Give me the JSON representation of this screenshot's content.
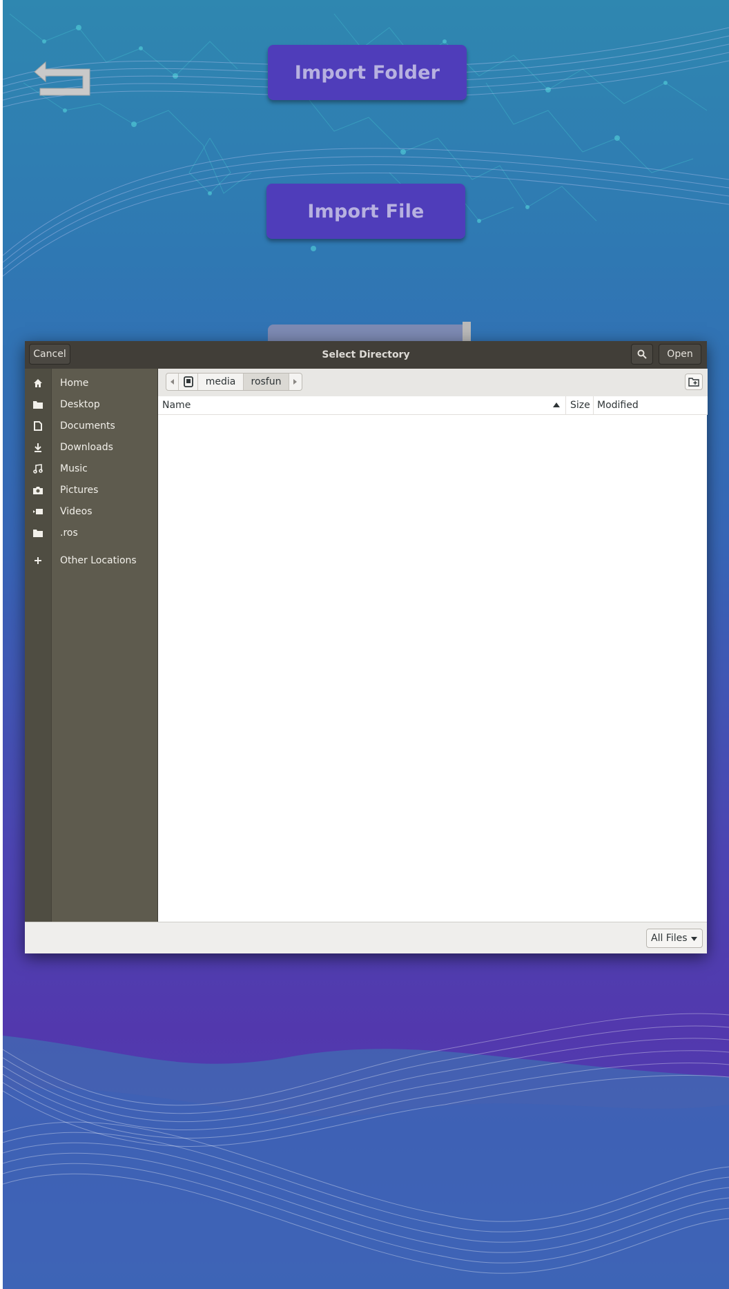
{
  "app": {
    "buttons": {
      "import_folder": "Import Folder",
      "import_file": "Import File"
    },
    "colors": {
      "background_top": "#2f87b0",
      "background_bottom": "#5238ad",
      "button": "#4f3dba",
      "button_text": "#b7b1e0"
    },
    "icons": {
      "back": "back-arrow-icon"
    }
  },
  "dialog": {
    "title": "Select Directory",
    "cancel_label": "Cancel",
    "open_label": "Open",
    "search_icon": "search-icon",
    "places": [
      {
        "label": "Home",
        "icon": "home-icon"
      },
      {
        "label": "Desktop",
        "icon": "folder-icon"
      },
      {
        "label": "Documents",
        "icon": "document-icon"
      },
      {
        "label": "Downloads",
        "icon": "download-icon"
      },
      {
        "label": "Music",
        "icon": "music-icon"
      },
      {
        "label": "Pictures",
        "icon": "camera-icon"
      },
      {
        "label": "Videos",
        "icon": "video-icon"
      },
      {
        "label": ".ros",
        "icon": "folder-icon"
      },
      {
        "label": "Other Locations",
        "icon": "plus-icon"
      }
    ],
    "path": {
      "segments": [
        "media",
        "rosfun"
      ],
      "active": "rosfun",
      "drive_icon": "drive-icon"
    },
    "columns": {
      "name": "Name",
      "size": "Size",
      "modified": "Modified"
    },
    "files": [],
    "filter": {
      "selected": "All Files"
    }
  }
}
